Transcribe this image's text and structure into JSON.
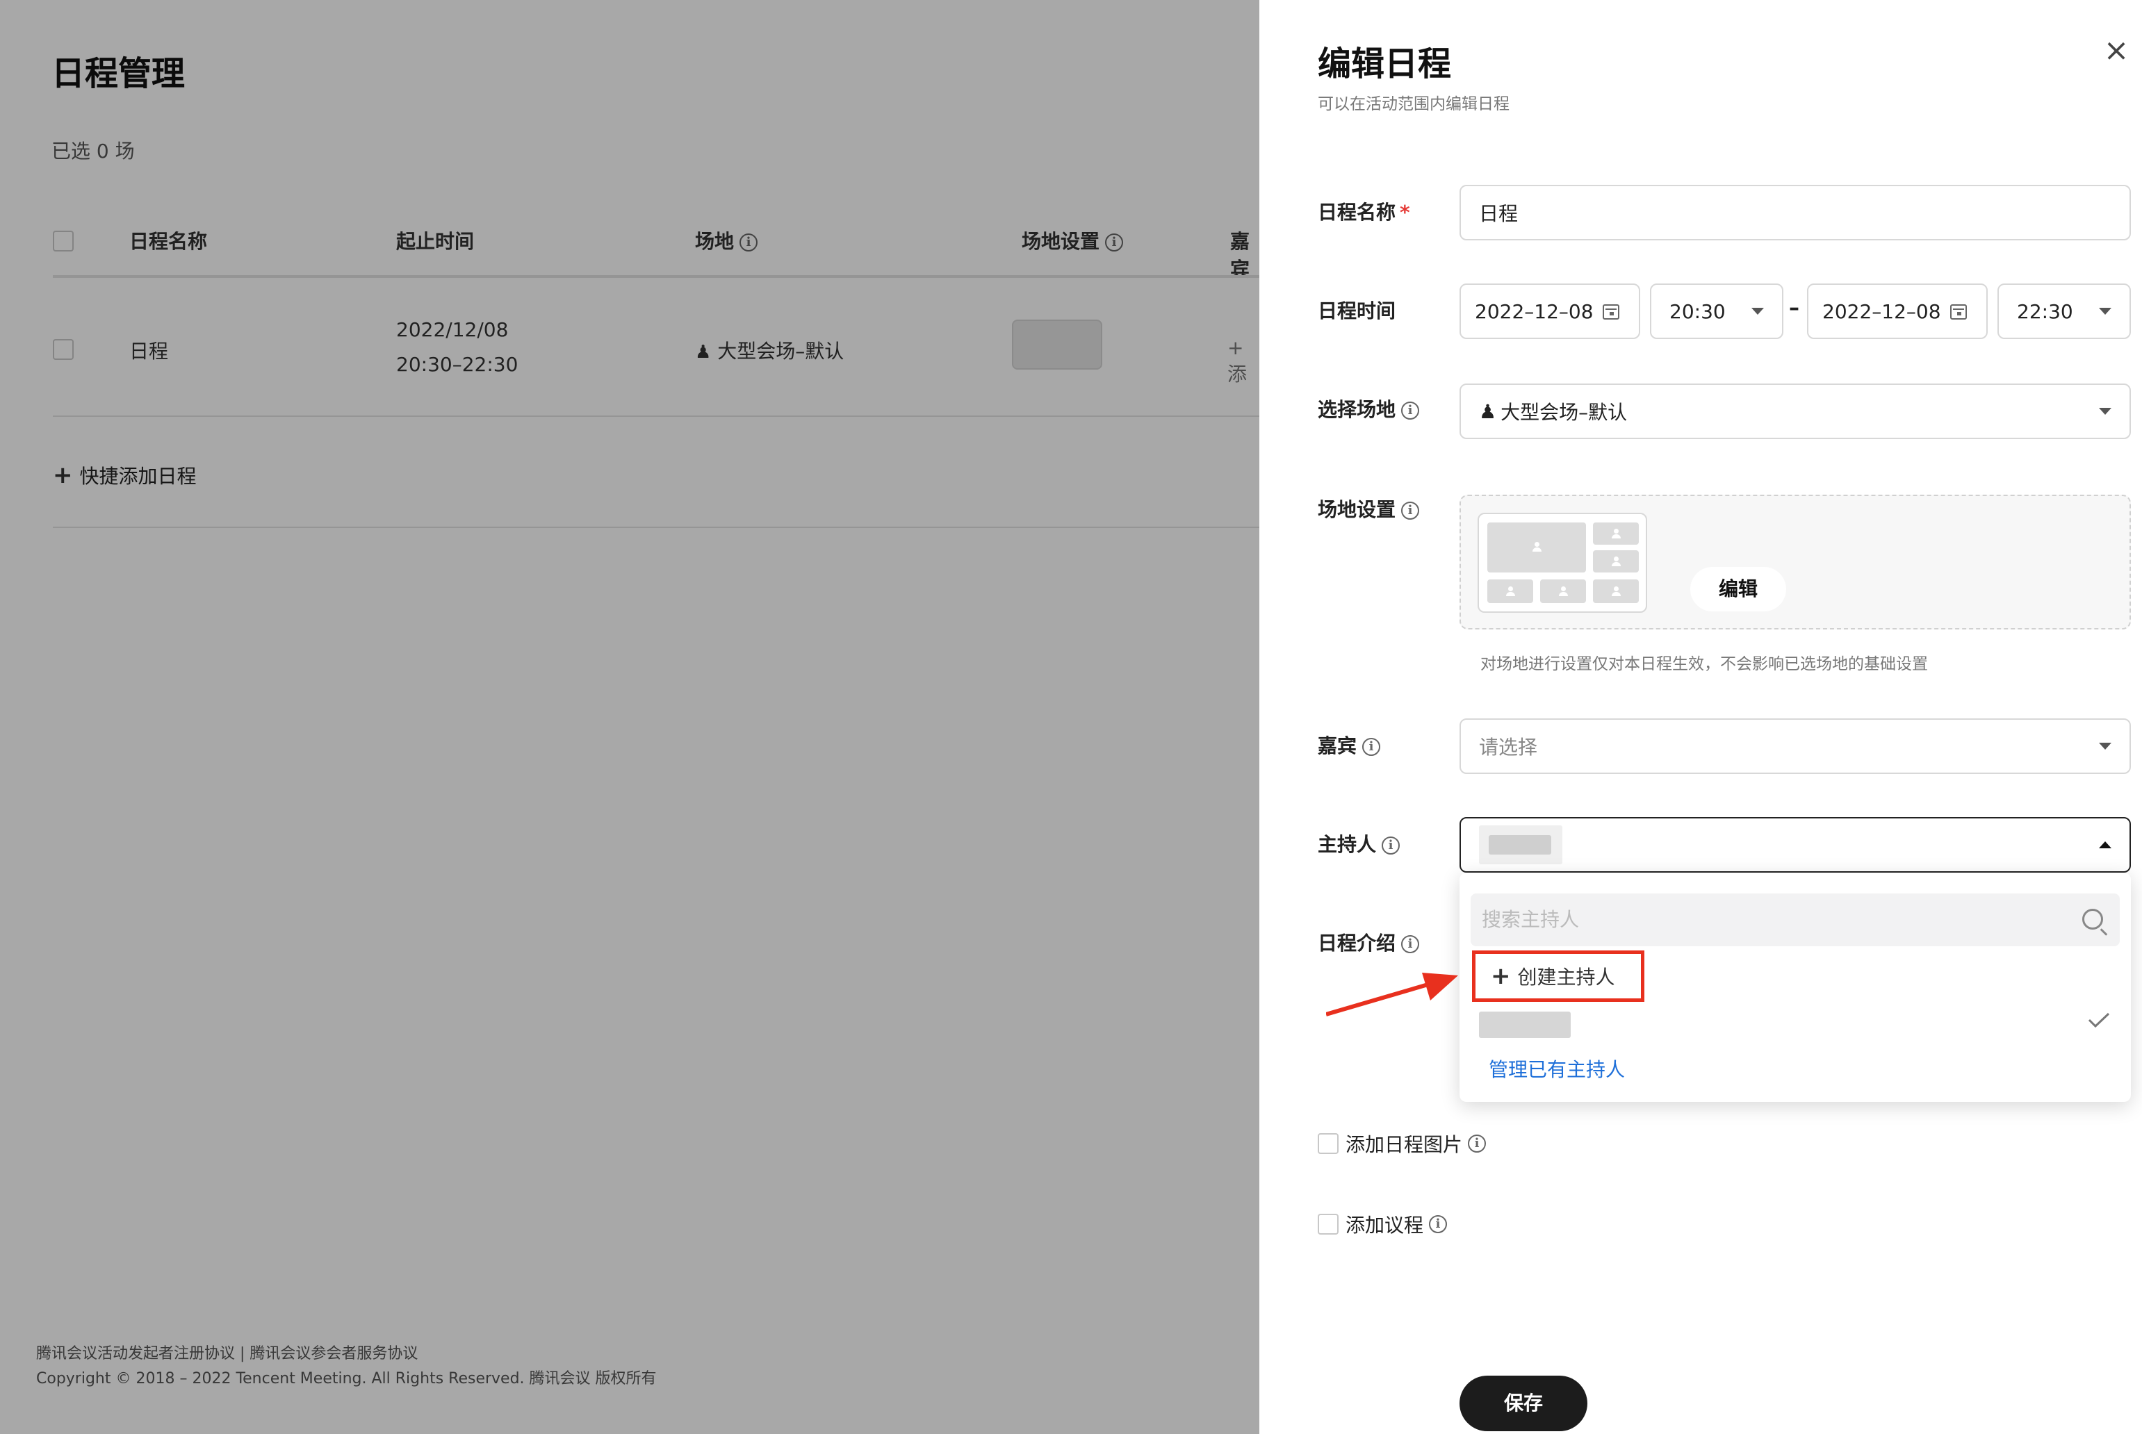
{
  "background": {
    "title": "日程管理",
    "selected_count": "已选 0 场",
    "table": {
      "headers": [
        "日程名称",
        "起止时间",
        "场地",
        "场地设置",
        "嘉宾"
      ],
      "rows": [
        {
          "name": "日程",
          "date": "2022/12/08",
          "time": "20:30–22:30",
          "venue": "大型会场–默认",
          "guest_add": "+ 添"
        }
      ]
    },
    "quick_add": "快捷添加日程",
    "footer": {
      "links": "腾讯会议活动发起者注册协议 | 腾讯会议参会者服务协议",
      "copyright": "Copyright © 2018 – 2022 Tencent Meeting. All Rights Reserved. 腾讯会议 版权所有"
    }
  },
  "drawer": {
    "title": "编辑日程",
    "subtitle": "可以在活动范围内编辑日程",
    "close_icon": "close-icon",
    "name_label": "日程名称",
    "required_mark": "*",
    "name_value": "日程",
    "time_label": "日程时间",
    "start_date": "2022–12–08",
    "start_time": "20:30",
    "time_separator": "–",
    "end_date": "2022–12–08",
    "end_time": "22:30",
    "venue_label": "选择场地",
    "venue_value": "大型会场–默认",
    "venue_settings_label": "场地设置",
    "edit_button": "编辑",
    "venue_hint": "对场地进行设置仅对本日程生效，不会影响已选场地的基础设置",
    "guest_label": "嘉宾",
    "guest_placeholder": "请选择",
    "host_label": "主持人",
    "intro_label": "日程介绍",
    "host_dropdown": {
      "search_placeholder": "搜索主持人",
      "create_label": "创建主持人",
      "manage_link": "管理已有主持人"
    },
    "add_image_label": "添加日程图片",
    "add_agenda_label": "添加议程",
    "save_button": "保存"
  },
  "colors": {
    "highlight_red": "#e8301e",
    "link_blue": "#1e6fd9",
    "save_button_bg": "#1c1c1c"
  }
}
